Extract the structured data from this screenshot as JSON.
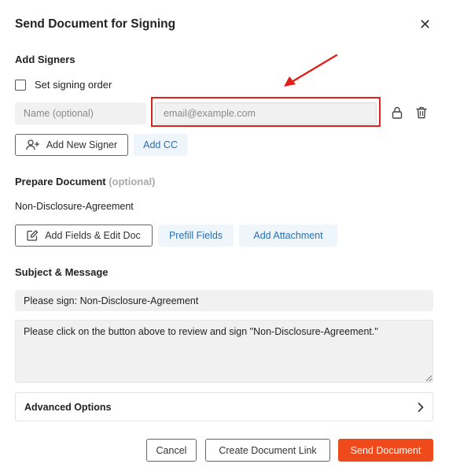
{
  "dialog": {
    "title": "Send Document for Signing"
  },
  "signers": {
    "heading": "Add Signers",
    "signing_order_label": "Set signing order",
    "name_placeholder": "Name (optional)",
    "email_placeholder": "email@example.com",
    "add_signer_label": "Add New Signer",
    "add_cc_label": "Add CC"
  },
  "prepare": {
    "heading": "Prepare Document",
    "optional_label": "(optional)",
    "document_name": "Non-Disclosure-Agreement",
    "add_fields_label": "Add Fields & Edit Doc",
    "prefill_label": "Prefill Fields",
    "attachment_label": "Add Attachment"
  },
  "message": {
    "heading": "Subject & Message",
    "subject_value": "Please sign: Non-Disclosure-Agreement",
    "body_value": "Please click on the button above to review and sign \"Non-Disclosure-Agreement.\""
  },
  "advanced": {
    "label": "Advanced Options"
  },
  "footer": {
    "cancel_label": "Cancel",
    "link_label": "Create Document Link",
    "send_label": "Send Document"
  },
  "colors": {
    "accent": "#ee4a1c",
    "link": "#2b6fb3",
    "annotation": "#e0201b"
  }
}
